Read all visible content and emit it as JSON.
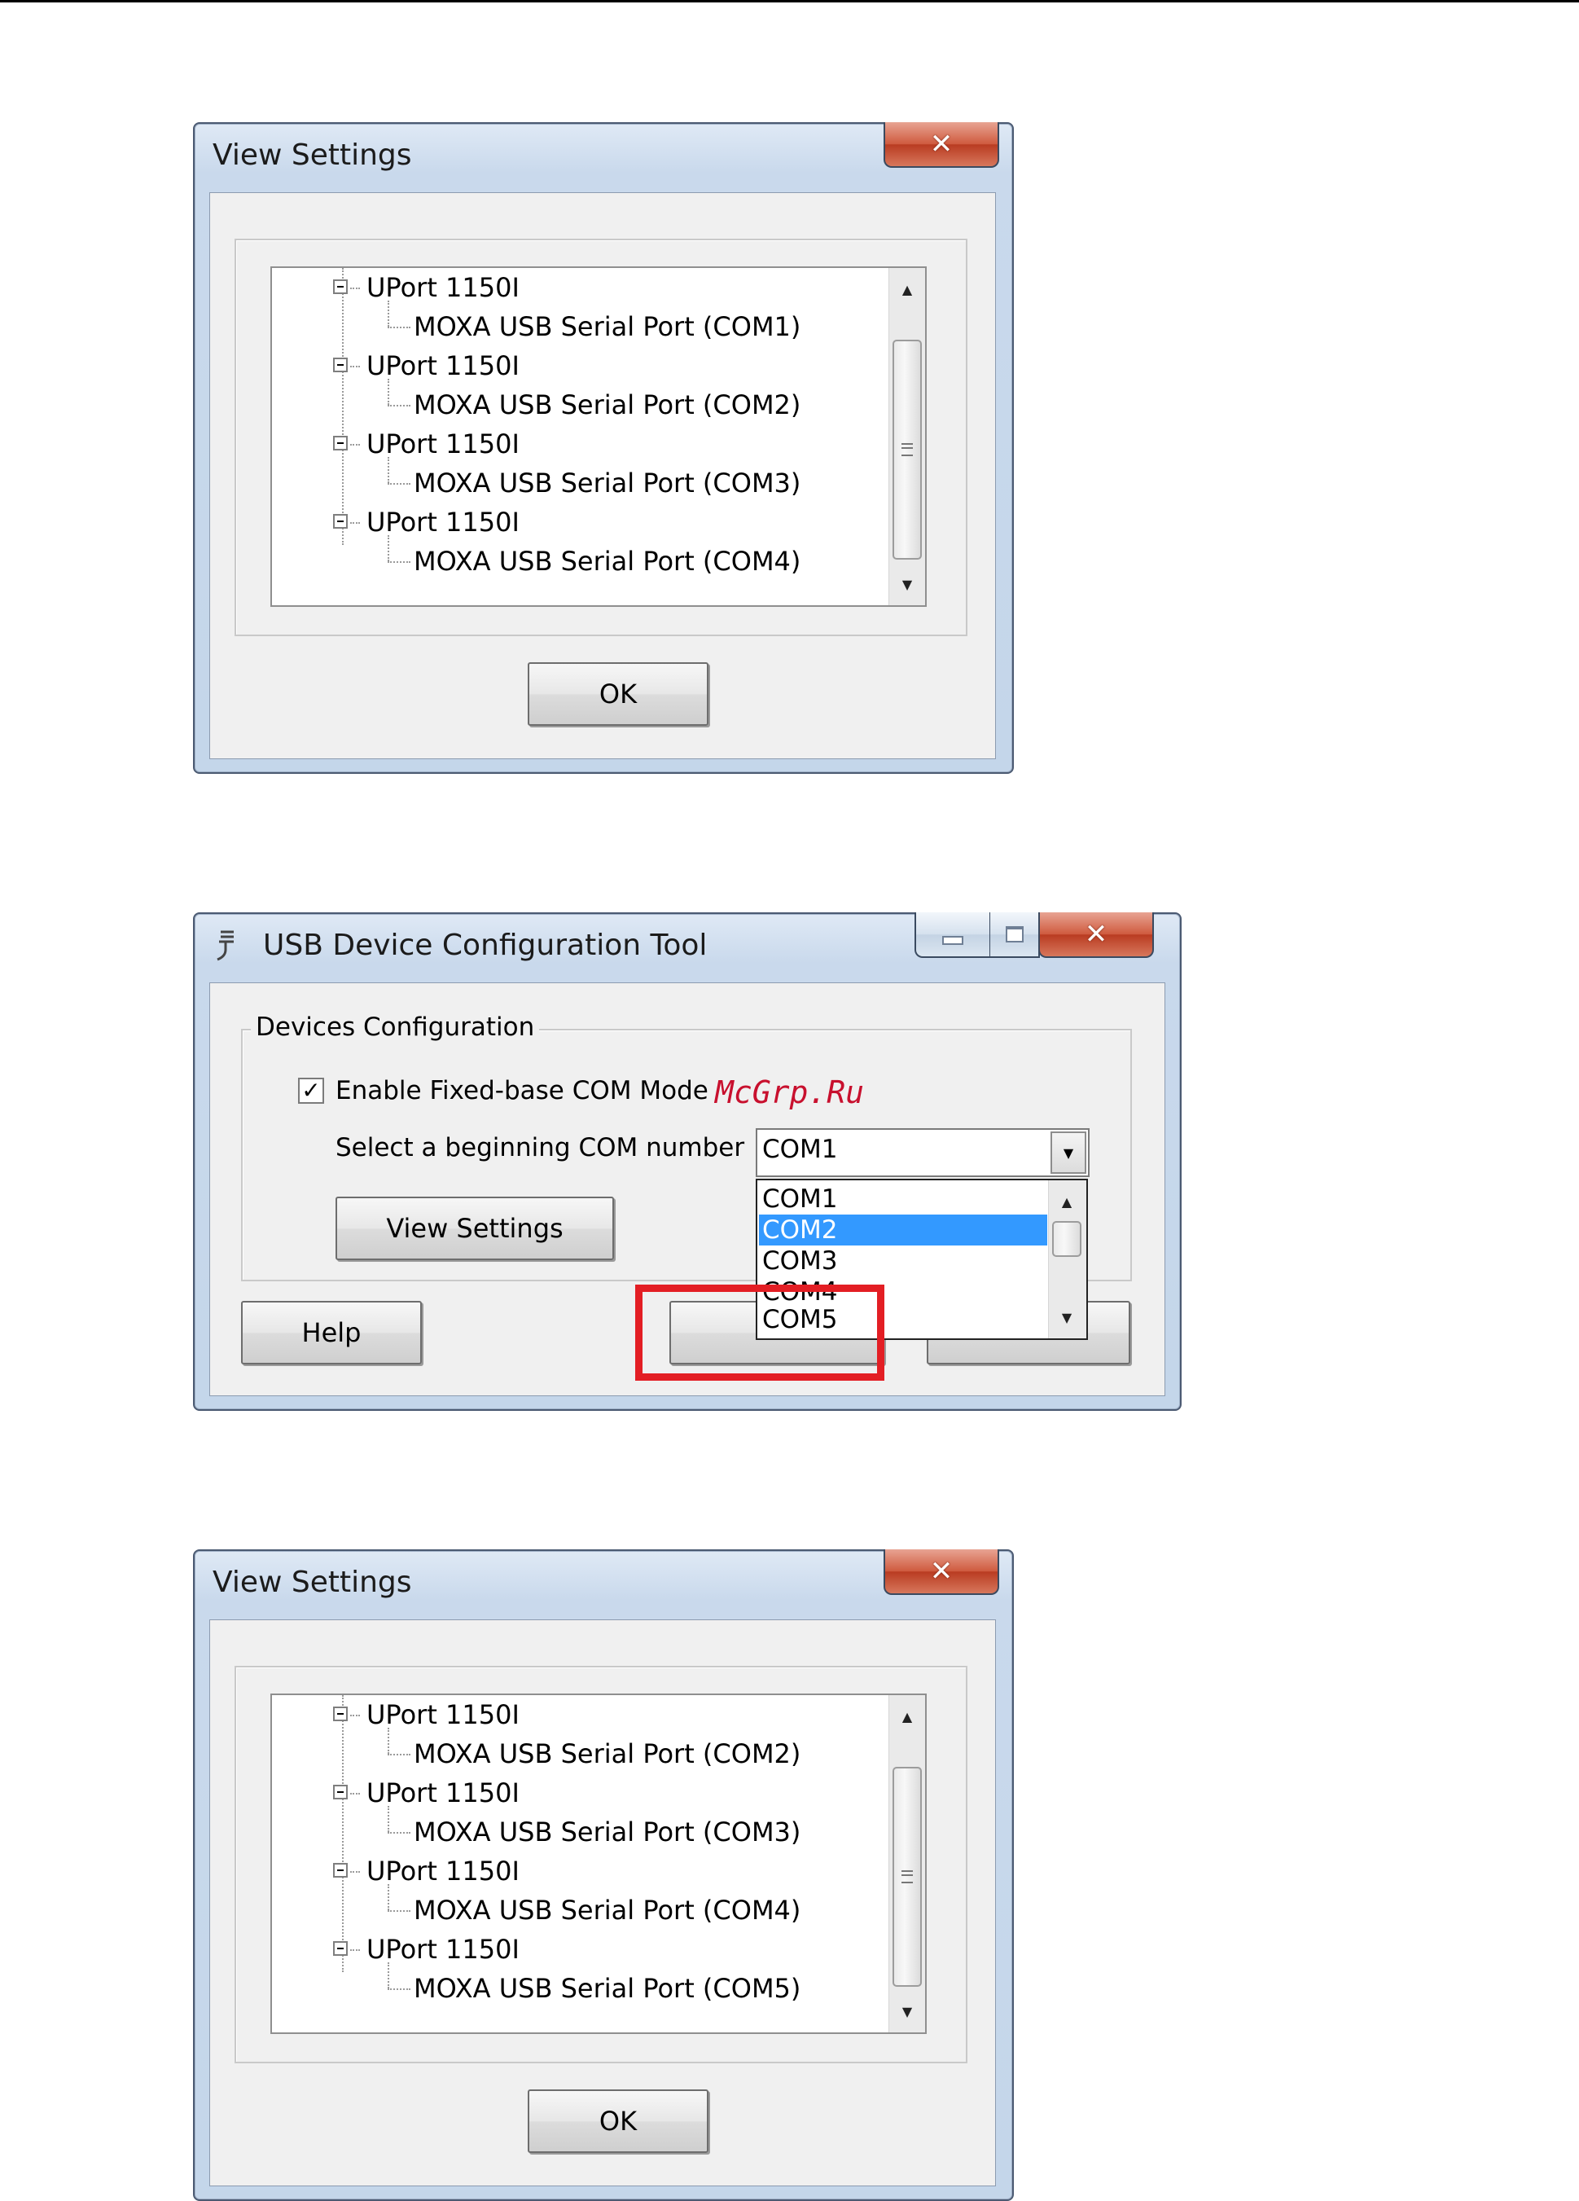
{
  "view_settings_before": {
    "title": "View Settings",
    "tree": [
      {
        "device": "UPort 1150I",
        "port": "MOXA USB Serial Port (COM1)"
      },
      {
        "device": "UPort 1150I",
        "port": "MOXA USB Serial Port (COM2)"
      },
      {
        "device": "UPort 1150I",
        "port": "MOXA USB Serial Port (COM3)"
      },
      {
        "device": "UPort 1150I",
        "port": "MOXA USB Serial Port (COM4)"
      }
    ],
    "ok_label": "OK"
  },
  "config_tool": {
    "title": "USB Device Configuration Tool",
    "group_label": "Devices Configuration",
    "checkbox_label": "Enable Fixed-base COM Mode",
    "checkbox_checked": true,
    "select_label": "Select a beginning COM number",
    "selected_value": "COM1",
    "dropdown_options": [
      "COM1",
      "COM2",
      "COM3",
      "COM4",
      "COM5"
    ],
    "highlighted_option": "COM2",
    "view_settings_label": "View Settings",
    "help_label": "Help",
    "watermark": "McGrp.Ru"
  },
  "view_settings_after": {
    "title": "View Settings",
    "tree": [
      {
        "device": "UPort 1150I",
        "port": "MOXA USB Serial Port (COM2)"
      },
      {
        "device": "UPort 1150I",
        "port": "MOXA USB Serial Port (COM3)"
      },
      {
        "device": "UPort 1150I",
        "port": "MOXA USB Serial Port (COM4)"
      },
      {
        "device": "UPort 1150I",
        "port": "MOXA USB Serial Port (COM5)"
      }
    ],
    "ok_label": "OK"
  },
  "icons": {
    "close": "close-icon",
    "minimize": "minimize-icon",
    "maximize": "maximize-icon",
    "app": "usb-plug-icon",
    "expand": "collapse-icon",
    "scroll_up": "scroll-up-icon",
    "scroll_down": "scroll-down-icon",
    "dropdown": "chevron-down-icon"
  },
  "colors": {
    "selection": "#3399ff",
    "highlight_box": "#e31e24",
    "watermark": "#c8102e",
    "close_button": "#c9462c"
  }
}
